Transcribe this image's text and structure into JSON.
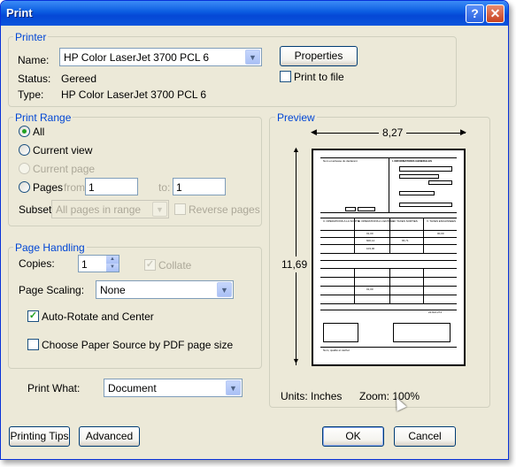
{
  "window": {
    "title": "Print"
  },
  "title_buttons": {
    "help": "?",
    "close": "✕"
  },
  "printer": {
    "legend": "Printer",
    "name_label": "Name:",
    "name_value": "HP Color LaserJet 3700 PCL 6",
    "status_label": "Status:",
    "status_value": "Gereed",
    "type_label": "Type:",
    "type_value": "HP Color LaserJet 3700 PCL 6",
    "properties_button": "Properties",
    "print_to_file": "Print to file"
  },
  "print_range": {
    "legend": "Print Range",
    "all": "All",
    "current_view": "Current view",
    "current_page": "Current page",
    "pages": "Pages",
    "from_label": "from:",
    "from_value": "1",
    "to_label": "to:",
    "to_value": "1",
    "subset_label": "Subset:",
    "subset_value": "All pages in range",
    "reverse_pages": "Reverse pages"
  },
  "page_handling": {
    "legend": "Page Handling",
    "copies_label": "Copies:",
    "copies_value": "1",
    "collate": "Collate",
    "scaling_label": "Page Scaling:",
    "scaling_value": "None",
    "auto_rotate": "Auto-Rotate and Center",
    "choose_paper": "Choose Paper Source by PDF page size"
  },
  "print_what": {
    "label": "Print What:",
    "value": "Document"
  },
  "preview": {
    "legend": "Preview",
    "width": "8,27",
    "height": "11,69",
    "units": "Units: Inches",
    "zoom": "Zoom: 100%"
  },
  "buttons": {
    "printing_tips": "Printing Tips",
    "advanced": "Advanced",
    "ok": "OK",
    "cancel": "Cancel"
  },
  "thumbnail": {
    "header_right": "I. INFORMATIONS GÉNÉRALES",
    "name_addr": "Nom et adresse du déclarant",
    "col1": "II. OPÉRATIONS A LA SORTIE",
    "col2": "III. OPÉRATIONS A L'ENTRÉE",
    "col3": "IV. TAXES SORTIES",
    "col4": "V. TAXES ENCAISSÉES",
    "v1": "01,00",
    "v2": "00,00",
    "v3": "600,14",
    "v4": "65,71",
    "v5": "103,00",
    "v6": "01,00",
    "footer": "Nom, qualité et cachet",
    "total": "22.821.274"
  }
}
